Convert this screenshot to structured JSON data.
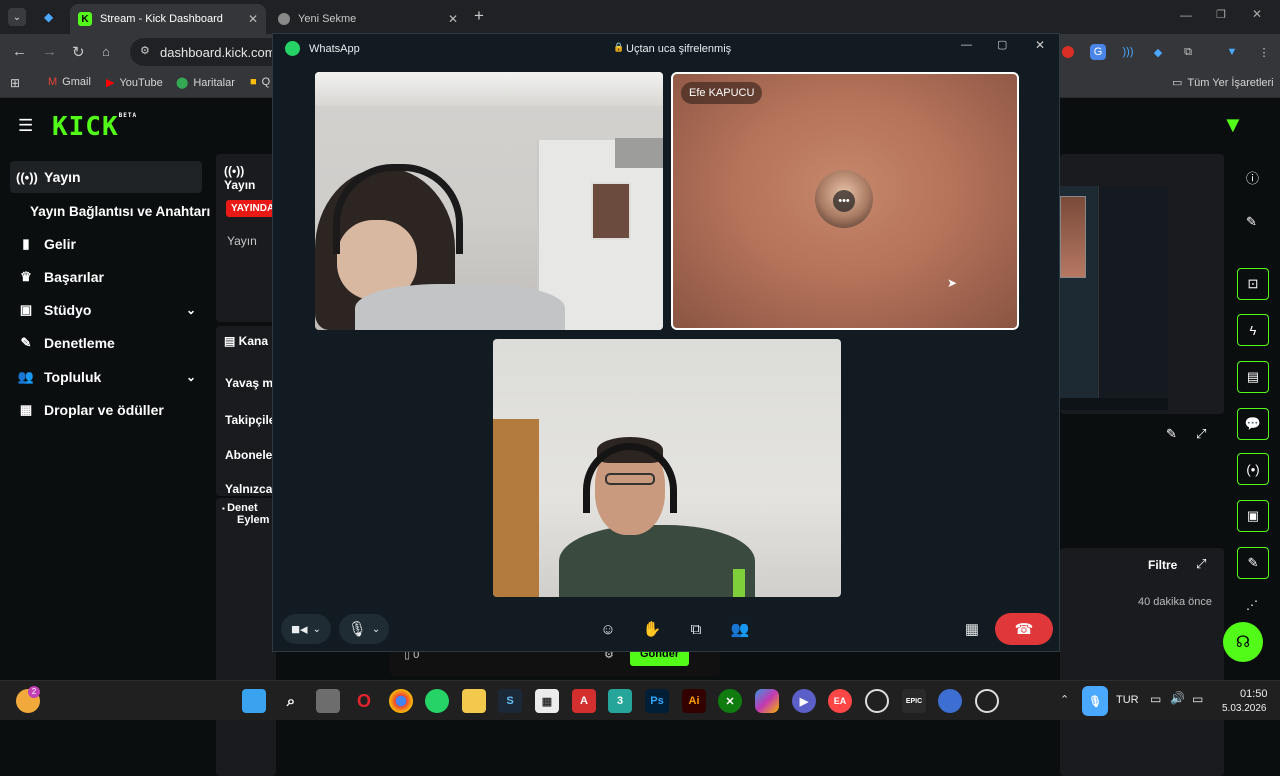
{
  "browser": {
    "tabs": [
      {
        "label": "Stream - Kick Dashboard",
        "active": true
      },
      {
        "label": "Yeni Sekme",
        "active": false
      }
    ],
    "address": "dashboard.kick.com/s",
    "bookmarks": [
      "Gmail",
      "YouTube",
      "Haritalar",
      "Q"
    ],
    "all_bookmarks": "Tüm Yer İşaretleri"
  },
  "kick": {
    "logo": "KICK",
    "logo_badge": "BETA",
    "sidebar": [
      {
        "label": "Yayın",
        "icon": "broadcast-icon",
        "active": true
      },
      {
        "label": "Yayın Bağlantısı ve Anahtarı",
        "icon": "",
        "sub": true
      },
      {
        "label": "Gelir",
        "icon": "chart-icon"
      },
      {
        "label": "Başarılar",
        "icon": "trophy-icon"
      },
      {
        "label": "Stüdyo",
        "icon": "studio-icon",
        "chevron": true
      },
      {
        "label": "Denetleme",
        "icon": "wrench-icon"
      },
      {
        "label": "Topluluk",
        "icon": "people-icon",
        "chevron": true
      },
      {
        "label": "Droplar ve ödüller",
        "icon": "gift-icon"
      }
    ],
    "stream_panel": {
      "title": "Yayın",
      "live_badge": "YAYINDA",
      "label": "Yayın"
    },
    "channel_panel": {
      "title": "Kana",
      "rows": [
        "Yavaş m",
        "Takipçile",
        "Abonele",
        "Yalnızca"
      ]
    },
    "moderation": {
      "title_line1": "Denet",
      "title_line2": "Eylem"
    },
    "chat": {
      "count": "0",
      "send": "Gönder"
    },
    "filter": "Filtre",
    "time_ago": "40 dakika önce"
  },
  "whatsapp": {
    "app_name": "WhatsApp",
    "encrypted": "Uçtan uca şifrelenmiş",
    "participant_name": "Efe KAPUCU"
  },
  "taskbar": {
    "language": "TUR",
    "time": "01:50",
    "date": "5.03.2026",
    "weather_badge": "2"
  },
  "colors": {
    "kick_green": "#53fc18",
    "end_call": "#e0373a",
    "live_red": "#e91916"
  }
}
